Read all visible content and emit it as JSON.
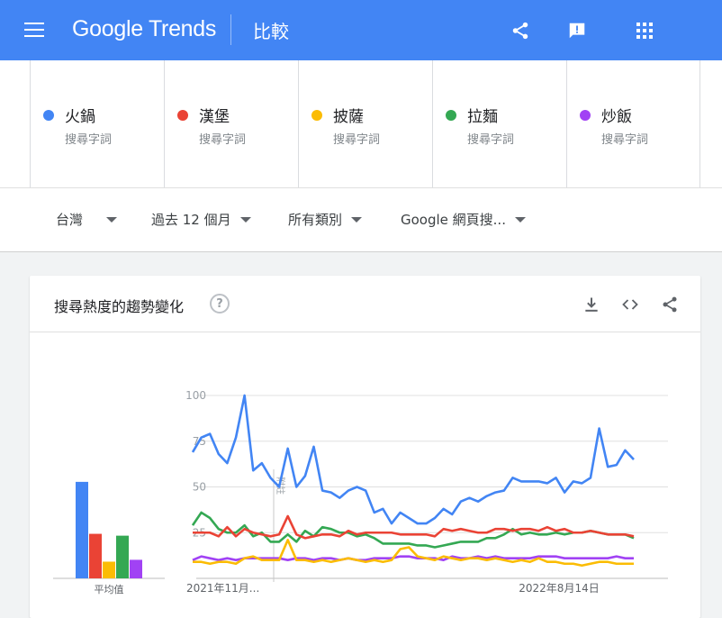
{
  "header": {
    "brand": "Google Trends",
    "page_title": "比較",
    "icons": [
      "menu-icon",
      "share-icon",
      "feedback-icon",
      "apps-icon"
    ]
  },
  "terms": [
    {
      "name": "火鍋",
      "sub": "搜尋字詞",
      "color": "#4285f4"
    },
    {
      "name": "漢堡",
      "sub": "搜尋字詞",
      "color": "#ea4335"
    },
    {
      "name": "披薩",
      "sub": "搜尋字詞",
      "color": "#fbbc04"
    },
    {
      "name": "拉麵",
      "sub": "搜尋字詞",
      "color": "#34a853"
    },
    {
      "name": "炒飯",
      "sub": "搜尋字詞",
      "color": "#a142f4"
    }
  ],
  "filters": {
    "region": "台灣",
    "period": "過去 12 個月",
    "category": "所有類別",
    "search_type": "Google 網頁搜..."
  },
  "card": {
    "title": "搜尋熱度的趨勢變化",
    "help": "?",
    "icons": [
      "download-icon",
      "embed-icon",
      "share-icon"
    ]
  },
  "chart_data": {
    "type": "line",
    "yticks": [
      "100",
      "75",
      "50",
      "25"
    ],
    "ylim": [
      0,
      100
    ],
    "xlabels": [
      "2021年11月...",
      "2022年8月14日"
    ],
    "annotation": "附註",
    "avg_label": "平均值",
    "averages": [
      52,
      24,
      9,
      23,
      10
    ],
    "series": [
      {
        "name": "火鍋",
        "color": "#4285f4",
        "values": [
          69,
          77,
          79,
          68,
          63,
          77,
          100,
          59,
          63,
          55,
          50,
          71,
          50,
          56,
          72,
          48,
          47,
          44,
          48,
          50,
          48,
          36,
          38,
          30,
          36,
          33,
          30,
          30,
          33,
          38,
          35,
          42,
          44,
          42,
          45,
          47,
          48,
          55,
          53,
          53,
          53,
          52,
          55,
          47,
          53,
          52,
          55,
          82,
          61,
          62,
          70,
          65
        ]
      },
      {
        "name": "漢堡",
        "color": "#ea4335",
        "values": [
          25,
          25,
          25,
          23,
          28,
          23,
          27,
          25,
          24,
          23,
          24,
          34,
          24,
          22,
          23,
          24,
          24,
          23,
          26,
          24,
          25,
          25,
          25,
          25,
          24,
          24,
          24,
          24,
          23,
          27,
          26,
          27,
          26,
          25,
          25,
          27,
          27,
          26,
          27,
          27,
          26,
          28,
          26,
          27,
          25,
          25,
          26,
          25,
          24,
          24,
          24,
          23
        ]
      },
      {
        "name": "披薩",
        "color": "#fbbc04",
        "values": [
          9,
          9,
          8,
          9,
          9,
          8,
          11,
          12,
          10,
          10,
          10,
          21,
          10,
          10,
          9,
          10,
          9,
          10,
          11,
          10,
          9,
          10,
          9,
          10,
          16,
          17,
          12,
          11,
          10,
          12,
          11,
          10,
          11,
          11,
          10,
          11,
          10,
          9,
          10,
          9,
          11,
          9,
          9,
          8,
          8,
          7,
          8,
          9,
          9,
          8,
          8,
          8
        ]
      },
      {
        "name": "拉麵",
        "color": "#34a853",
        "values": [
          29,
          36,
          33,
          27,
          25,
          25,
          29,
          23,
          25,
          20,
          20,
          24,
          20,
          26,
          23,
          28,
          27,
          25,
          25,
          23,
          24,
          22,
          19,
          19,
          19,
          19,
          18,
          18,
          17,
          18,
          19,
          20,
          20,
          20,
          22,
          22,
          24,
          27,
          24,
          25,
          24,
          24,
          25,
          24,
          25,
          25,
          26,
          25,
          24,
          24,
          24,
          22
        ]
      },
      {
        "name": "炒飯",
        "color": "#a142f4",
        "values": [
          10,
          12,
          11,
          10,
          11,
          10,
          11,
          11,
          11,
          11,
          11,
          10,
          11,
          11,
          10,
          11,
          11,
          10,
          11,
          10,
          10,
          11,
          11,
          11,
          12,
          12,
          11,
          11,
          11,
          10,
          12,
          11,
          11,
          12,
          11,
          12,
          11,
          11,
          11,
          11,
          12,
          12,
          12,
          11,
          11,
          11,
          11,
          11,
          11,
          12,
          11,
          11
        ]
      }
    ]
  }
}
